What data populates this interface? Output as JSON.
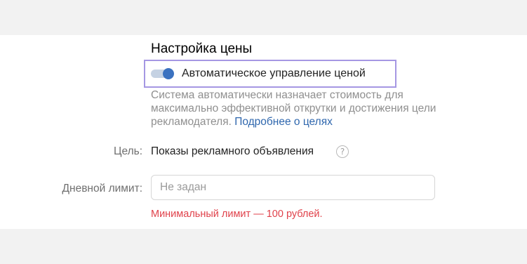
{
  "price_settings": {
    "title": "Настройка цены",
    "auto_toggle": {
      "label": "Автоматическое управление ценой",
      "enabled": true
    },
    "description": {
      "text": "Система автоматически назначает стоимость для максимально эффективной открутки и достижения цели рекламодателя.",
      "link_text": "Подробнее о целях"
    },
    "goal": {
      "label": "Цель:",
      "value": "Показы рекламного объявления",
      "help_icon": "?"
    },
    "daily_limit": {
      "label": "Дневной лимит:",
      "placeholder": "Не задан",
      "value": "",
      "error": "Минимальный лимит — 100 рублей."
    }
  },
  "colors": {
    "accent": "#3b72c0",
    "link": "#2f67ae",
    "error": "#e0424b",
    "focus_border": "#a597e3"
  }
}
